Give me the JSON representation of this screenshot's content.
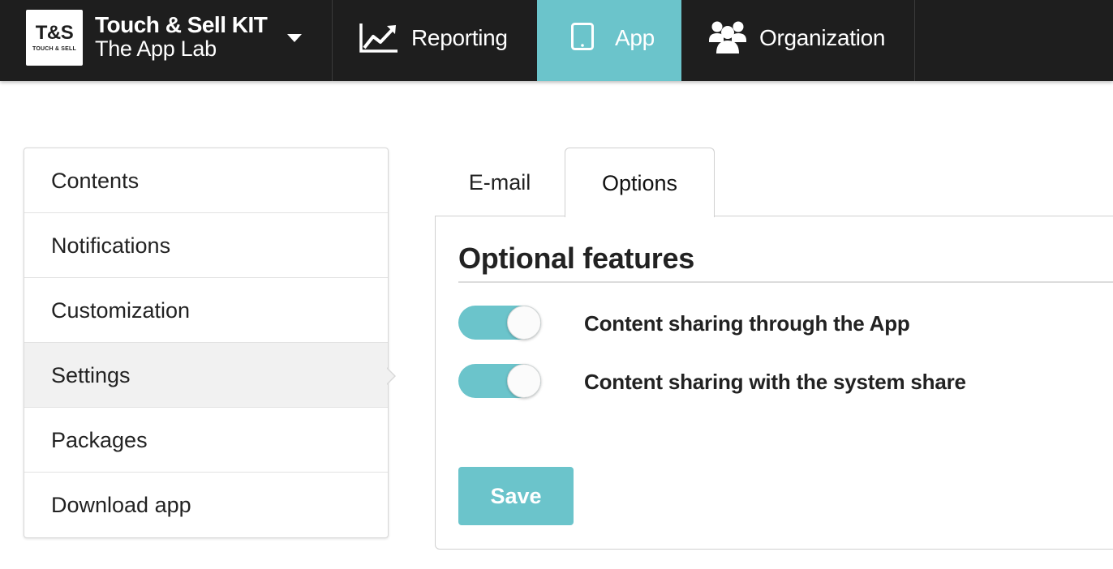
{
  "brand": {
    "logo_main": "T&S",
    "logo_sub": "TOUCH & SELL",
    "title": "Touch & Sell KIT",
    "subtitle": "The App Lab"
  },
  "nav": {
    "reporting": {
      "label": "Reporting",
      "icon": "line-chart-icon"
    },
    "app": {
      "label": "App",
      "icon": "tablet-icon",
      "active": true
    },
    "organization": {
      "label": "Organization",
      "icon": "users-group-icon"
    }
  },
  "sidebar": {
    "items": [
      {
        "label": "Contents"
      },
      {
        "label": "Notifications"
      },
      {
        "label": "Customization"
      },
      {
        "label": "Settings",
        "active": true
      },
      {
        "label": "Packages"
      },
      {
        "label": "Download app"
      }
    ]
  },
  "tabs": [
    {
      "label": "E-mail",
      "active": false
    },
    {
      "label": "Options",
      "active": true
    }
  ],
  "options_panel": {
    "section_title": "Optional features",
    "features": [
      {
        "label": "Content sharing through the App",
        "enabled": true
      },
      {
        "label": "Content sharing with the system share",
        "enabled": true
      }
    ],
    "save_label": "Save"
  },
  "colors": {
    "topbar_bg": "#1e1e1e",
    "accent": "#6bc4cb",
    "active_sidebar_bg": "#f1f1f1"
  }
}
